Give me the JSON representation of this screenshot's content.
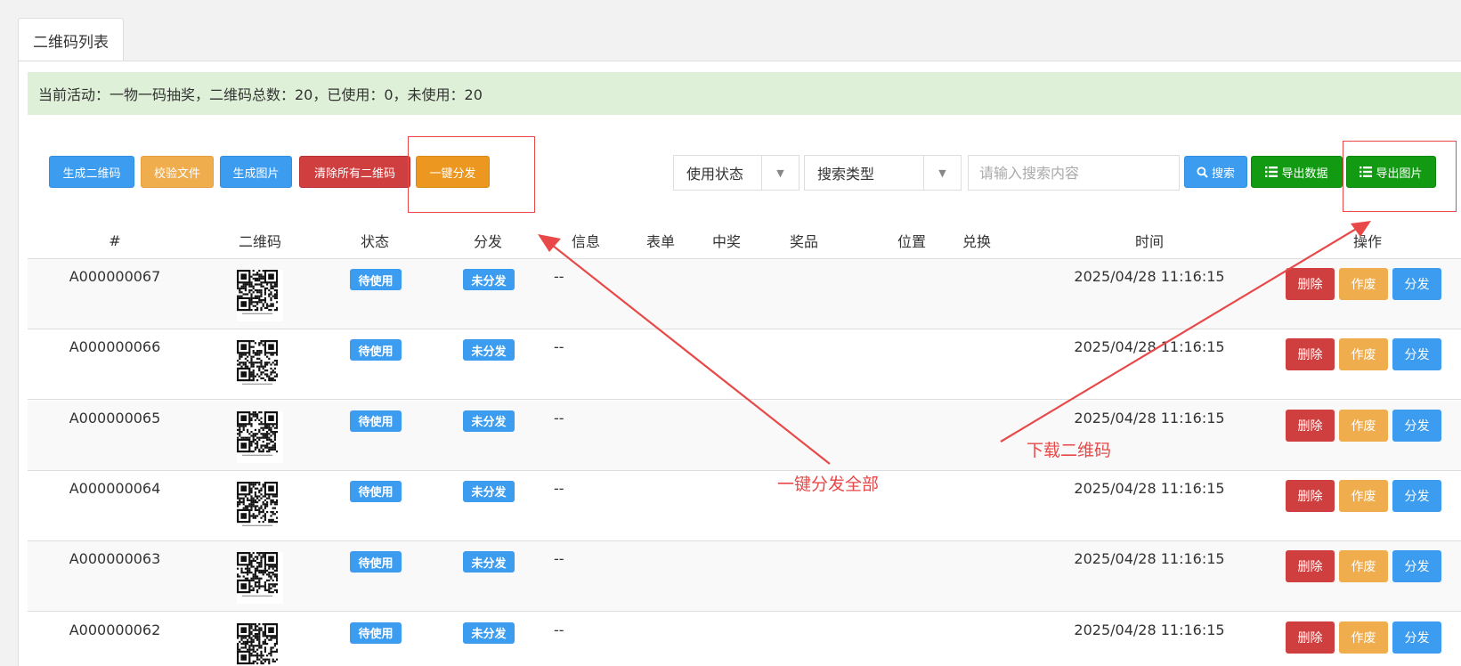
{
  "tab": {
    "label": "二维码列表"
  },
  "alert": {
    "text": "当前活动：一物一码抽奖，二维码总数：20，已使用：0，未使用：20"
  },
  "toolbar": {
    "generate_qr": "生成二维码",
    "verify_file": "校验文件",
    "generate_image": "生成图片",
    "clear_all": "清除所有二维码",
    "distribute_all": "一键分发",
    "status_select": "使用状态",
    "search_type_select": "搜索类型",
    "search_placeholder": "请输入搜索内容",
    "search_button": "搜索",
    "export_data": "导出数据",
    "export_images": "导出图片"
  },
  "table": {
    "headers": [
      "#",
      "二维码",
      "状态",
      "分发",
      "信息",
      "表单",
      "中奖",
      "奖品",
      "位置",
      "兑换",
      "时间",
      "操作"
    ],
    "rows": [
      {
        "code": "A000000067",
        "status": "待使用",
        "distribution": "未分发",
        "info": "--",
        "time": "2025/04/28 11:16:15"
      },
      {
        "code": "A000000066",
        "status": "待使用",
        "distribution": "未分发",
        "info": "--",
        "time": "2025/04/28 11:16:15"
      },
      {
        "code": "A000000065",
        "status": "待使用",
        "distribution": "未分发",
        "info": "--",
        "time": "2025/04/28 11:16:15"
      },
      {
        "code": "A000000064",
        "status": "待使用",
        "distribution": "未分发",
        "info": "--",
        "time": "2025/04/28 11:16:15"
      },
      {
        "code": "A000000063",
        "status": "待使用",
        "distribution": "未分发",
        "info": "--",
        "time": "2025/04/28 11:16:15"
      },
      {
        "code": "A000000062",
        "status": "待使用",
        "distribution": "未分发",
        "info": "--",
        "time": "2025/04/28 11:16:15"
      }
    ],
    "actions": {
      "delete": "删除",
      "void": "作废",
      "distribute": "分发"
    }
  },
  "annotations": {
    "distribute_all_note": "一键分发全部",
    "download_note": "下载二维码"
  },
  "colors": {
    "primary_blue": "#3c9cef",
    "warning_orange": "#f0ad4e",
    "danger_red": "#cf3f3f",
    "success_green": "#139a13",
    "alert_bg": "#dff0d8",
    "annotation_red": "#e84848"
  },
  "icons": {
    "search": "search-icon",
    "list": "list-icon",
    "caret": "caret-down-icon"
  }
}
